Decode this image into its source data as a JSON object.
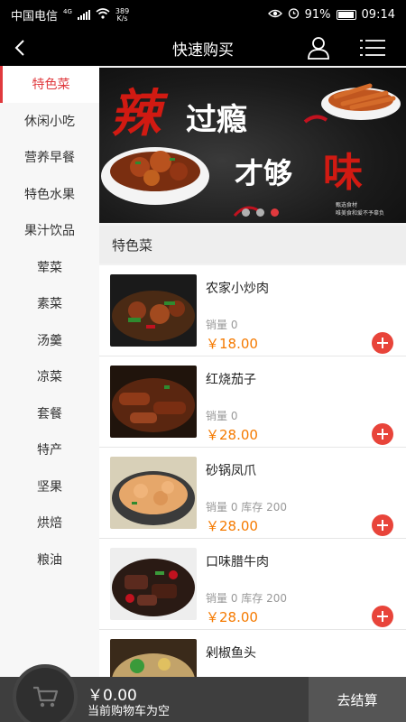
{
  "status_bar": {
    "carrier": "中国电信",
    "network": "4G",
    "speed_value": "389",
    "speed_unit": "K/s",
    "battery": "91%",
    "time": "09:14"
  },
  "header": {
    "title": "快速购买",
    "icons": {
      "back": "back-arrow-icon",
      "user": "user-icon",
      "menu": "list-menu-icon"
    }
  },
  "sidebar": {
    "items": [
      {
        "label": "特色菜",
        "active": true
      },
      {
        "label": "休闲小吃"
      },
      {
        "label": "营养早餐"
      },
      {
        "label": "特色水果"
      },
      {
        "label": "果汁饮品"
      },
      {
        "label": "荤菜"
      },
      {
        "label": "素菜"
      },
      {
        "label": "汤羹"
      },
      {
        "label": "凉菜"
      },
      {
        "label": "套餐"
      },
      {
        "label": "特产"
      },
      {
        "label": "坚果"
      },
      {
        "label": "烘焙"
      },
      {
        "label": "粮油"
      }
    ]
  },
  "banner": {
    "line1_big": "辣",
    "line1_rest": "过瘾",
    "line2_rest": "才够",
    "line2_big": "味",
    "small_line1": "甄选食材",
    "small_line2": "唯美食和爱不予辜负",
    "accent_color": "#d11a12"
  },
  "section": {
    "title": "特色菜"
  },
  "products": [
    {
      "name": "农家小炒肉",
      "sales": "销量 0",
      "price": "￥18.00"
    },
    {
      "name": "红烧茄子",
      "sales": "销量 0",
      "price": "￥28.00"
    },
    {
      "name": "砂锅凤爪",
      "sales": "销量 0 库存 200",
      "price": "￥28.00"
    },
    {
      "name": "口味腊牛肉",
      "sales": "销量 0 库存 200",
      "price": "￥28.00"
    },
    {
      "name": "剁椒鱼头",
      "sales": "",
      "price": ""
    }
  ],
  "cart": {
    "amount": "￥0.00",
    "hint": "当前购物车为空",
    "checkout_label": "去结算",
    "icon": "shopping-cart-icon"
  },
  "colors": {
    "accent": "#e0393d",
    "price": "#f57a00",
    "bar": "#3e3e3e"
  }
}
